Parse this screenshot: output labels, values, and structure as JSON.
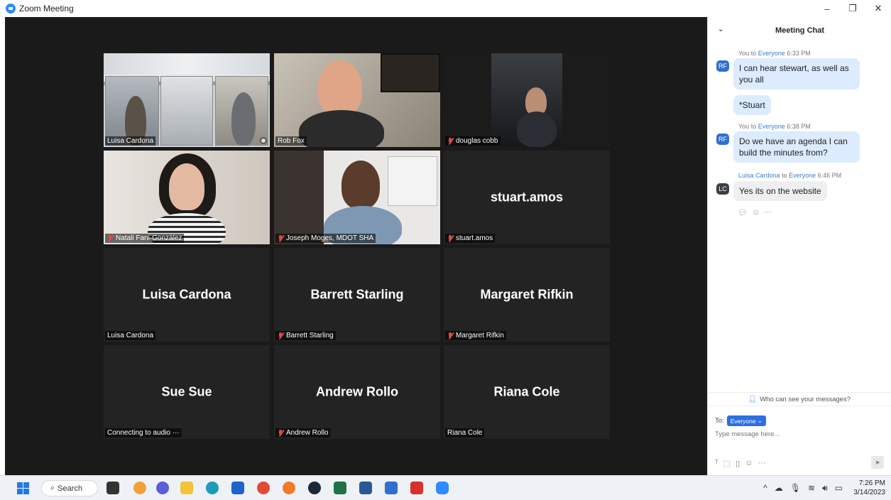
{
  "window": {
    "title": "Zoom Meeting",
    "controls": [
      "–",
      "❐",
      "✕"
    ]
  },
  "gallery": {
    "tiles": [
      {
        "id": "luisa-video",
        "label": "Luisa Cardona",
        "muted": false,
        "big_name": "",
        "active": true
      },
      {
        "id": "rob",
        "label": "Rob Fox",
        "muted": false,
        "big_name": ""
      },
      {
        "id": "douglas",
        "label": "douglas cobb",
        "muted": true,
        "big_name": ""
      },
      {
        "id": "natali",
        "label": "Natali Fani-González",
        "muted": true,
        "big_name": ""
      },
      {
        "id": "joseph",
        "label": "Joseph Moges, MDOT SHA",
        "muted": true,
        "big_name": ""
      },
      {
        "id": "stuart",
        "label": "stuart.amos",
        "muted": true,
        "big_name": "stuart.amos"
      },
      {
        "id": "luisa2",
        "label": "Luisa Cardona",
        "muted": false,
        "big_name": "Luisa Cardona"
      },
      {
        "id": "barrett",
        "label": "Barrett Starling",
        "muted": true,
        "big_name": "Barrett Starling"
      },
      {
        "id": "margaret",
        "label": "Margaret Rifkin",
        "muted": true,
        "big_name": "Margaret Rifkin"
      },
      {
        "id": "sue",
        "label": "Connecting to audio ···",
        "muted": false,
        "big_name": "Sue Sue"
      },
      {
        "id": "andrew",
        "label": "Andrew Rollo",
        "muted": true,
        "big_name": "Andrew Rollo"
      },
      {
        "id": "riana",
        "label": "Riana Cole",
        "muted": false,
        "big_name": "Riana Cole"
      }
    ]
  },
  "chat": {
    "title": "Meeting Chat",
    "messages": [
      {
        "from": "You",
        "to_word": "to",
        "to": "Everyone",
        "time": "6:33 PM",
        "avatar": "RF",
        "lines": [
          "I can hear stewart, as well as",
          "you all"
        ]
      },
      {
        "text": "*Stuart"
      },
      {
        "from": "You",
        "to_word": "to",
        "to": "Everyone",
        "time": "6:38 PM",
        "avatar": "RF",
        "lines": [
          "Do we have an agenda I can",
          "build the minutes from?"
        ]
      },
      {
        "from": "Luisa Cardona",
        "to_word": "to",
        "to": "Everyone",
        "time": "6:46 PM",
        "avatar": "LC",
        "lines": [
          "Yes its on the website"
        ]
      }
    ],
    "who_can_see": "Who can see your messages?",
    "to_label": "To:",
    "recipient": "Everyone",
    "input_placeholder": "Type message here..."
  },
  "taskbar": {
    "search_label": "Search",
    "time": "7:26 PM",
    "date": "3/14/2023",
    "accent": "#1f7ae6"
  }
}
